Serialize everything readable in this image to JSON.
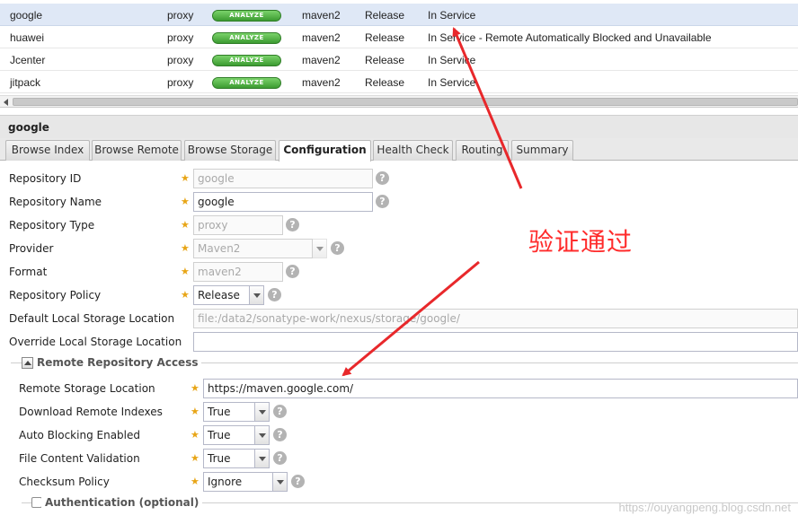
{
  "repositories": [
    {
      "name": "google",
      "type": "proxy",
      "analyze": "ANALYZE",
      "format": "maven2",
      "policy": "Release",
      "status": "In Service",
      "selected": true
    },
    {
      "name": "huawei",
      "type": "proxy",
      "analyze": "ANALYZE",
      "format": "maven2",
      "policy": "Release",
      "status": "In Service - Remote Automatically Blocked and Unavailable"
    },
    {
      "name": "Jcenter",
      "type": "proxy",
      "analyze": "ANALYZE",
      "format": "maven2",
      "policy": "Release",
      "status": "In Service"
    },
    {
      "name": "jitpack",
      "type": "proxy",
      "analyze": "ANALYZE",
      "format": "maven2",
      "policy": "Release",
      "status": "In Service"
    }
  ],
  "panel": {
    "title": "google",
    "tabs": [
      {
        "label": "Browse Index"
      },
      {
        "label": "Browse Remote"
      },
      {
        "label": "Browse Storage"
      },
      {
        "label": "Configuration",
        "active": true
      },
      {
        "label": "Health Check"
      },
      {
        "label": "Routing"
      },
      {
        "label": "Summary"
      }
    ]
  },
  "form": {
    "repository_id": {
      "label": "Repository ID",
      "value": "google"
    },
    "repository_name": {
      "label": "Repository Name",
      "value": "google"
    },
    "repository_type": {
      "label": "Repository Type",
      "value": "proxy"
    },
    "provider": {
      "label": "Provider",
      "value": "Maven2"
    },
    "format": {
      "label": "Format",
      "value": "maven2"
    },
    "repository_policy": {
      "label": "Repository Policy",
      "value": "Release"
    },
    "default_local_storage": {
      "label": "Default Local Storage Location",
      "value": "file:/data2/sonatype-work/nexus/storage/google/"
    },
    "override_local_storage": {
      "label": "Override Local Storage Location",
      "value": ""
    },
    "remote_access": {
      "legend": "Remote Repository Access",
      "remote_storage_location": {
        "label": "Remote Storage Location",
        "value": "https://maven.google.com/"
      },
      "download_remote_indexes": {
        "label": "Download Remote Indexes",
        "value": "True"
      },
      "auto_blocking": {
        "label": "Auto Blocking Enabled",
        "value": "True"
      },
      "file_content_validation": {
        "label": "File Content Validation",
        "value": "True"
      },
      "checksum_policy": {
        "label": "Checksum Policy",
        "value": "Ignore"
      }
    },
    "authentication": {
      "legend": "Authentication (optional)"
    }
  },
  "help_glyph": "?",
  "required_glyph": "★",
  "annotation": "验证通过",
  "watermark": "https://ouyangpeng.blog.csdn.net",
  "colors": {
    "annotation": "#ff2b2b",
    "analyze_button": "#3c9b31",
    "required_star": "#e8a516"
  }
}
